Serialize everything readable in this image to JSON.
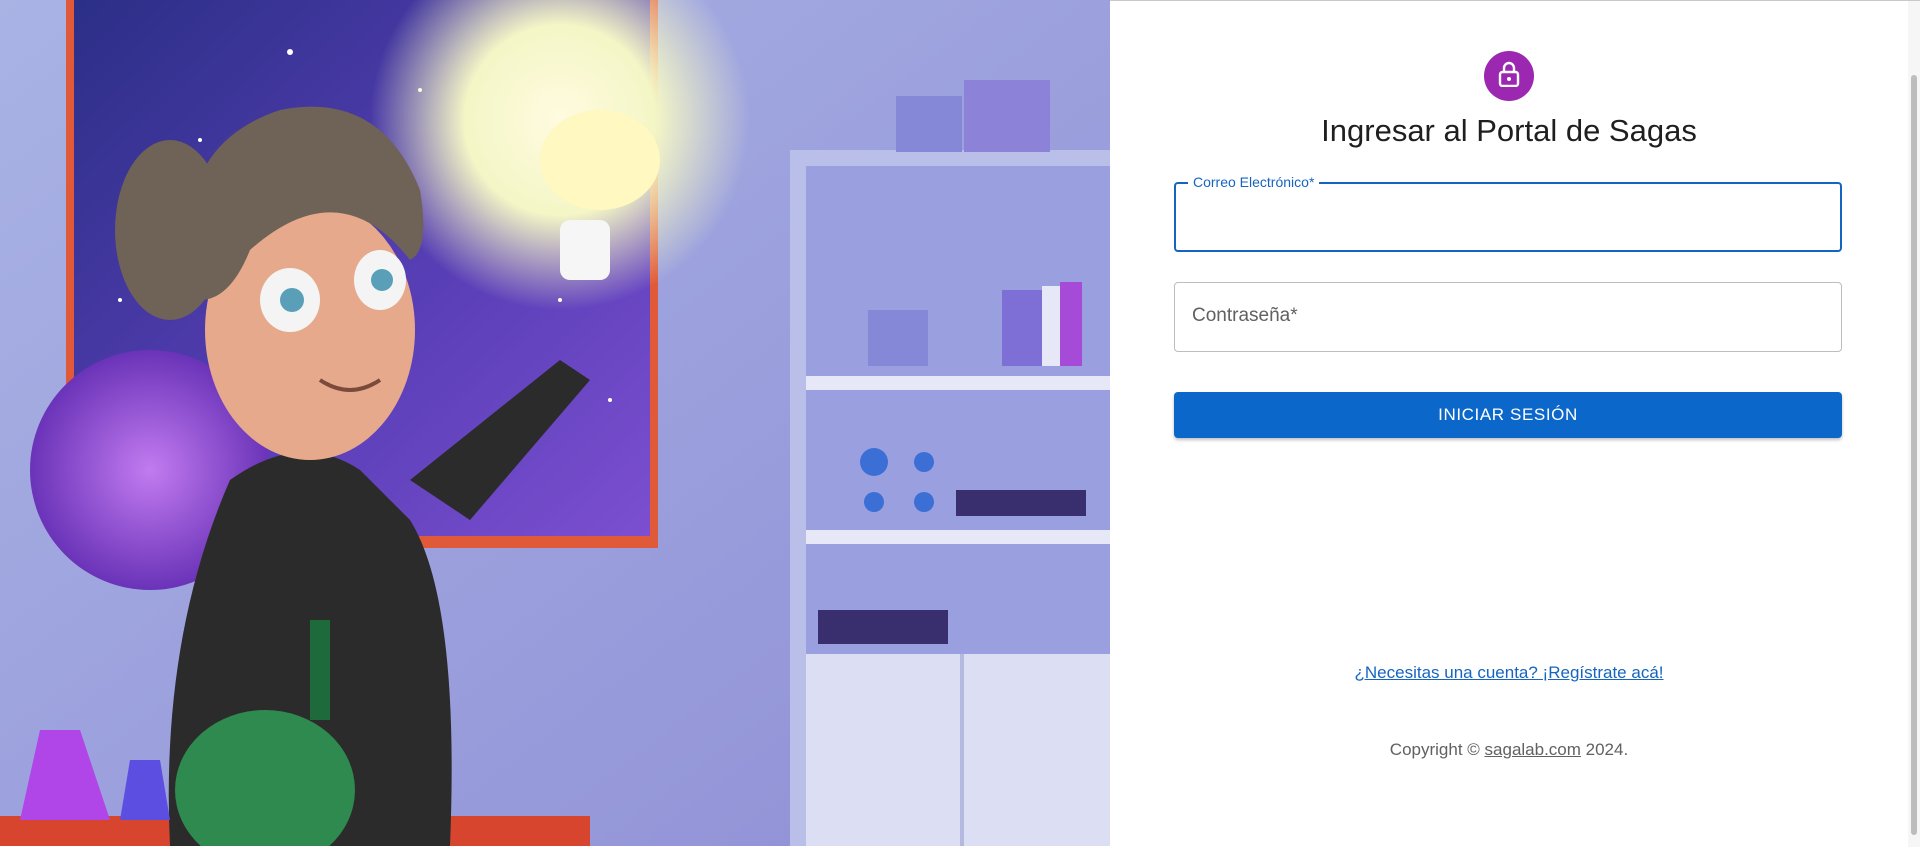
{
  "login": {
    "title": "Ingresar al Portal de Sagas",
    "email_label": "Correo Electrónico",
    "password_label": "Contraseña",
    "required_mark": "*",
    "email_value": "",
    "password_value": "",
    "submit_label": "INICIAR SESIÓN",
    "register_link": "¿Necesitas una cuenta? ¡Regístrate acá!"
  },
  "footer": {
    "prefix": "Copyright © ",
    "site": "sagalab.com",
    "suffix": " 2024."
  },
  "icons": {
    "avatar": "lock-icon",
    "hero": "scientist-lab-illustration"
  },
  "colors": {
    "avatar_bg": "#9c27b0",
    "primary": "#0b67c9",
    "focus": "#1565c0"
  }
}
